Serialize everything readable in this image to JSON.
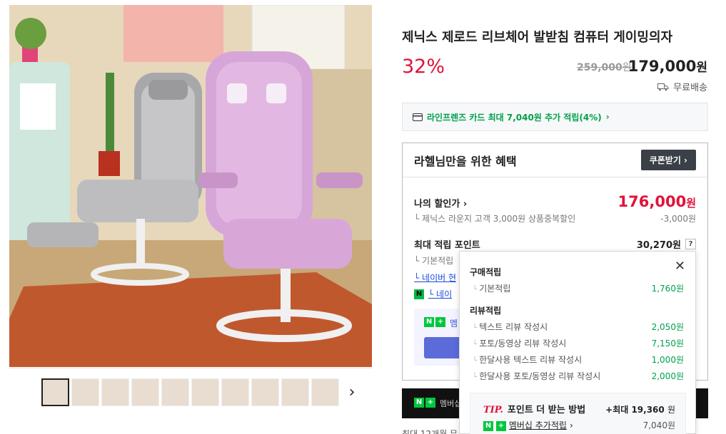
{
  "product": {
    "title": "제닉스 제로드 리브체어 발받침 컴퓨터 게이밍의자",
    "discount": "32%",
    "old_price": "259,000",
    "old_price_unit": "원",
    "price": "179,000",
    "price_unit": "원",
    "shipping": "무료배송"
  },
  "card_bar": {
    "text": "라인프렌즈 카드 최대 7,040원 추가 적립(4%)",
    "chevron": "›"
  },
  "benefit": {
    "title": "라헬님만을 위한 혜택",
    "coupon_button": "쿠폰받기 ›",
    "my_discount_label": "나의 할인가 ›",
    "my_discount_value": "176,000",
    "my_discount_unit": "원",
    "sub_label": "└ 제닉스 라운지 고객 3,000원 상품중복할인",
    "sub_value": "-3,000원",
    "points_label": "최대 적립 포인트",
    "points_value": "30,270원",
    "points_help": "?",
    "point_rows": [
      "└ 기본적립",
      "└ 네이버 현",
      "└ 네이"
    ],
    "membership_label": "멤"
  },
  "popup": {
    "close": "✕",
    "purchase_title": "구매적립",
    "purchase_rows": [
      {
        "label": "기본적립",
        "value": "1,760원"
      }
    ],
    "review_title": "리뷰적립",
    "review_rows": [
      {
        "label": "텍스트 리뷰 작성시",
        "value": "2,050원"
      },
      {
        "label": "포토/동영상 리뷰 작성시",
        "value": "7,150원"
      },
      {
        "label": "한달사용 텍스트 리뷰 작성시",
        "value": "1,000원"
      },
      {
        "label": "한달사용 포토/동영상 리뷰 작성시",
        "value": "2,000원"
      }
    ],
    "tip_mark": "TIP.",
    "tip_title": "포인트 더 받는 방법",
    "tip_max": "+최대 19,360",
    "tip_max_unit": "원",
    "tip_membership": "멤버십 추가적립",
    "tip_membership_value": "7,040원"
  },
  "membership_bar": {
    "label": "멤버십"
  },
  "bottom_peek": "최대 12개월 무",
  "thumbnails_next": "›",
  "icons": {
    "card": "card-icon",
    "truck": "truck-icon",
    "naver_n": "N",
    "plus": "+"
  }
}
